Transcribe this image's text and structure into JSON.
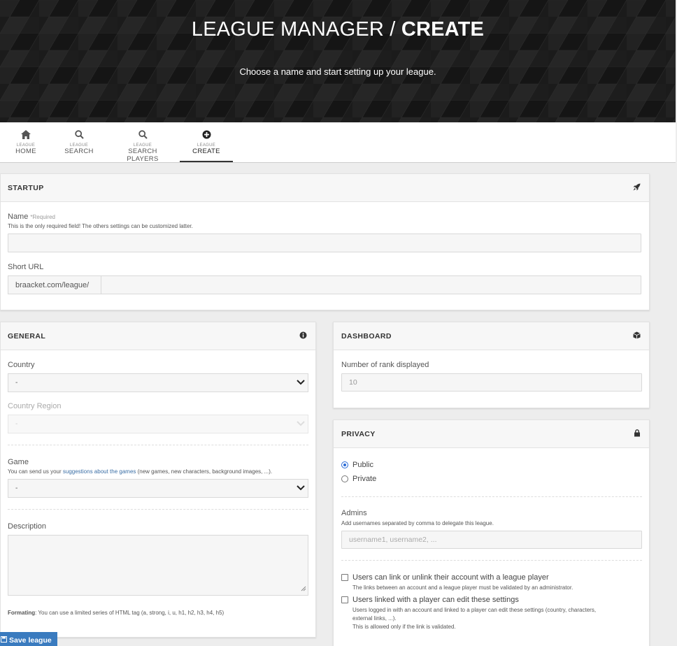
{
  "hero": {
    "title_light": "LEAGUE MANAGER / ",
    "title_bold": "CREATE",
    "subtitle": "Choose a name and start setting up your league."
  },
  "nav": {
    "items": [
      {
        "small": "LEAGUE",
        "label": "HOME",
        "icon": "home-icon"
      },
      {
        "small": "LEAGUE",
        "label": "SEARCH",
        "icon": "search-icon"
      },
      {
        "small": "LEAGUE",
        "label": "SEARCH PLAYERS",
        "icon": "search-icon"
      },
      {
        "small": "LEAGUE",
        "label": "CREATE",
        "icon": "plus-circle-icon",
        "active": true
      }
    ]
  },
  "startup": {
    "title": "STARTUP",
    "icon": "rocket-icon",
    "name_label": "Name",
    "name_required": "*Required",
    "name_help": "This is the only required field! The others settings can be customized latter.",
    "name_value": "",
    "short_url_label": "Short URL",
    "short_url_prefix": "braacket.com/league/",
    "short_url_value": ""
  },
  "general": {
    "title": "GENERAL",
    "icon": "info-circle-icon",
    "country_label": "Country",
    "country_value": "-",
    "region_label": "Country Region",
    "region_value": "-",
    "game_label": "Game",
    "game_help_before": "You can send us your ",
    "game_help_link": "suggestions about the games",
    "game_help_after": " (new games, new characters, background images, ...).",
    "game_value": "-",
    "description_label": "Description",
    "formatting_bold": "Formating",
    "formatting_text": ": You can use a limited series of HTML tag (a, strong, i, u, h1, h2, h3, h4, h5)"
  },
  "dashboard": {
    "title": "DASHBOARD",
    "icon": "cube-icon",
    "rank_label": "Number of rank displayed",
    "rank_value": "10"
  },
  "privacy": {
    "title": "PRIVACY",
    "icon": "lock-icon",
    "options": [
      {
        "label": "Public",
        "checked": true
      },
      {
        "label": "Private",
        "checked": false
      }
    ],
    "admins_label": "Admins",
    "admins_help": "Add usernames separated by comma to delegate this league.",
    "admins_placeholder": "username1, username2, ...",
    "check1_label": "Users can link or unlink their account with a league player",
    "check1_help": "The links between an account and a league player must be validated by an administrator.",
    "check2_label": "Users linked with a player can edit these settings",
    "check2_help1": "Users logged in with an account and linked to a player can edit these settings (country, characters,",
    "check2_help2": "external links, ...).",
    "check2_help3": "This is allowed only if the link is validated."
  },
  "save_label": "Save league",
  "colors": {
    "accent": "#3a7bbf",
    "hero_bg": "#1a1a1a",
    "radio": "#2a6bd6"
  }
}
